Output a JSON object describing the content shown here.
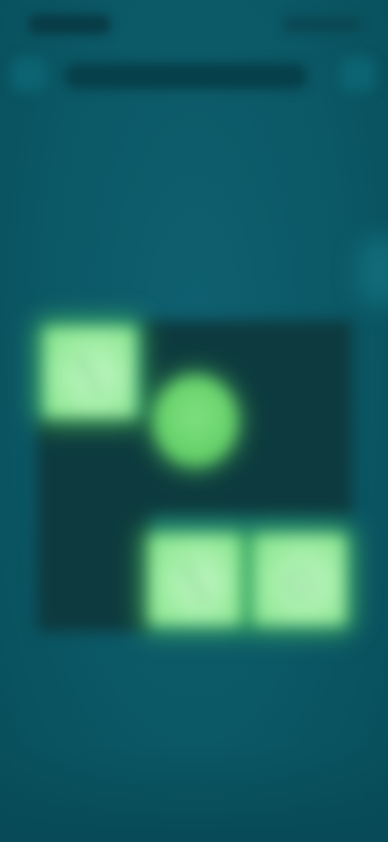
{
  "status_bar": {
    "time": "",
    "icons": ""
  },
  "header": {
    "back_icon": "back-arrow-icon",
    "title": "",
    "settings_icon": "gear-icon"
  },
  "board": {
    "rows": 3,
    "cols": 3,
    "tiles": [
      {
        "row": 0,
        "col": 0,
        "state": "lit",
        "icon": "diagonal-line-icon"
      },
      {
        "row": 2,
        "col": 1,
        "state": "lit",
        "icon": "diagonal-line-icon"
      },
      {
        "row": 2,
        "col": 2,
        "state": "lit",
        "icon": "circle-icon"
      }
    ],
    "orb": {
      "between": [
        [
          0,
          1
        ],
        [
          1,
          1
        ]
      ],
      "icon": "orb-icon"
    }
  },
  "colors": {
    "background": "#0b5866",
    "board_dark": "#0d3a3e",
    "tile_glow": "#a4eea8",
    "orb": "#66d16a"
  }
}
